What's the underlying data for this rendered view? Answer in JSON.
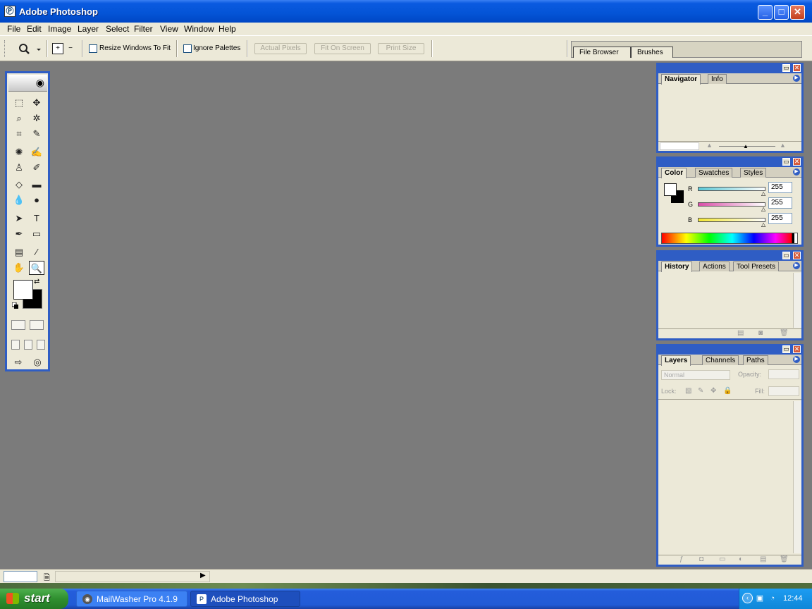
{
  "window": {
    "title": "Adobe Photoshop",
    "app_icon_glyph": "Ⓟ",
    "minimize_glyph": "_",
    "maximize_glyph": "□",
    "close_glyph": "✕"
  },
  "menu": [
    "File",
    "Edit",
    "Image",
    "Layer",
    "Select",
    "Filter",
    "View",
    "Window",
    "Help"
  ],
  "options_bar": {
    "tool_preset_icon": "magnifier-icon",
    "zoom_in_glyph": "+",
    "zoom_out_glyph": "−",
    "resize_windows_label": "Resize Windows To Fit",
    "resize_windows_checked": false,
    "ignore_palettes_label": "Ignore Palettes",
    "ignore_palettes_checked": false,
    "actual_pixels_label": "Actual Pixels",
    "fit_on_screen_label": "Fit On Screen",
    "print_size_label": "Print Size",
    "palette_well_tabs": [
      "File Browser",
      "Brushes"
    ]
  },
  "toolbox": {
    "tools": [
      {
        "name": "rectangular-marquee-tool",
        "glyph": "⬚"
      },
      {
        "name": "move-tool",
        "glyph": "✥"
      },
      {
        "name": "lasso-tool",
        "glyph": "⌕"
      },
      {
        "name": "magic-wand-tool",
        "glyph": "✲"
      },
      {
        "name": "crop-tool",
        "glyph": "⌗"
      },
      {
        "name": "slice-tool",
        "glyph": "✎"
      },
      {
        "name": "healing-brush-tool",
        "glyph": "✺"
      },
      {
        "name": "brush-tool",
        "glyph": "✍"
      },
      {
        "name": "clone-stamp-tool",
        "glyph": "♙"
      },
      {
        "name": "history-brush-tool",
        "glyph": "✐"
      },
      {
        "name": "eraser-tool",
        "glyph": "◇"
      },
      {
        "name": "gradient-tool",
        "glyph": "▬"
      },
      {
        "name": "blur-tool",
        "glyph": "💧"
      },
      {
        "name": "dodge-tool",
        "glyph": "●"
      },
      {
        "name": "path-selection-tool",
        "glyph": "➤"
      },
      {
        "name": "type-tool",
        "glyph": "T"
      },
      {
        "name": "pen-tool",
        "glyph": "✒"
      },
      {
        "name": "rectangle-tool",
        "glyph": "▭"
      },
      {
        "name": "notes-tool",
        "glyph": "▤"
      },
      {
        "name": "eyedropper-tool",
        "glyph": "⁄"
      },
      {
        "name": "hand-tool",
        "glyph": "✋"
      },
      {
        "name": "zoom-tool",
        "glyph": "🔍"
      }
    ],
    "active_tool": "zoom-tool",
    "foreground_color": "#ffffff",
    "background_color": "#000000",
    "swap_glyph": "⇄",
    "jump_glyph": "⇨"
  },
  "palettes": {
    "navigator": {
      "tabs": [
        "Navigator",
        "Info"
      ],
      "active": "Navigator"
    },
    "color": {
      "tabs": [
        "Color",
        "Swatches",
        "Styles"
      ],
      "active": "Color",
      "channels": [
        {
          "label": "R",
          "value": "255",
          "gradient": "#5bc8d6"
        },
        {
          "label": "G",
          "value": "255",
          "gradient": "#d94fa8"
        },
        {
          "label": "B",
          "value": "255",
          "gradient": "#f2e632"
        }
      ]
    },
    "history": {
      "tabs": [
        "History",
        "Actions",
        "Tool Presets"
      ],
      "active": "History"
    },
    "layers": {
      "tabs": [
        "Layers",
        "Channels",
        "Paths"
      ],
      "active": "Layers",
      "blend_mode": "Normal",
      "opacity_label": "Opacity:",
      "lock_label": "Lock:",
      "fill_label": "Fill:"
    }
  },
  "status_bar": {
    "zoom_value": "",
    "status_text": ""
  },
  "taskbar": {
    "start_label": "start",
    "tasks": [
      {
        "label": "MailWasher Pro 4.1.9",
        "active": false
      },
      {
        "label": "Adobe Photoshop",
        "active": true
      }
    ],
    "clock": "12:44"
  }
}
